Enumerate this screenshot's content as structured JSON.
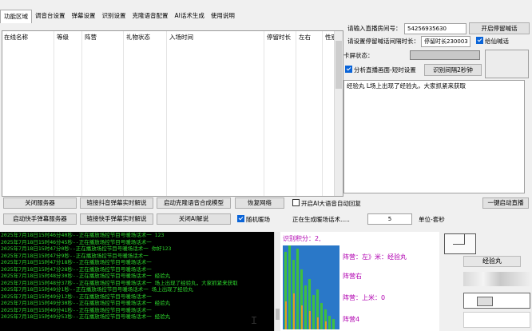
{
  "menu": {
    "tabs": [
      "功能区域",
      "调音台设置",
      "弹幕设置",
      "识别设置",
      "克隆语音配置",
      "AI话术生成",
      "使用说明"
    ]
  },
  "table": {
    "columns": [
      "在线名称",
      "等级",
      "阵营",
      "礼物状态",
      "入场时间",
      "停留时长",
      "左右",
      "性别"
    ]
  },
  "settings": {
    "room_label": "请输入直播房间号：",
    "room_value": "54256935630",
    "start_shout_button": "开启停留喊话",
    "shout_interval_label": "请设置停留喊话间隔时长：",
    "shout_interval_value": "停留时长230003",
    "fairy_shout": "给仙喊话",
    "card_status_label": "卡屏状态：",
    "analyze_check": "分析直播画面-短时设置",
    "recognize_interval_button": "识别间隔2秒钟",
    "message_text": "经验丸 L场上出现了经验丸，大家抓紧来获取"
  },
  "buttons": {
    "close_server": "关闭服务器",
    "link_douyin": "链接抖音弹幕实时解说",
    "start_clone": "启动克隆语音合成模型",
    "restore_network": "恢复网络",
    "ai_auto_reply": "开启AI大语音自动回复",
    "one_key_start": "一键启动直播",
    "start_kuaishou": "启动快手弹幕服务器",
    "link_kuaishou": "链接快手弹幕实时解说",
    "close_ai": "关闭AI解说",
    "random_warm": "随机暖场",
    "generating": "正在生成暖场话术.....",
    "count_value": "5",
    "unit": "单位-套秒"
  },
  "console": {
    "lines": [
      "2025年7月18日15时46分40秒--正在播放场控节目号暖场话术一 123",
      "2025年7月18日15时46分45秒--正在播放场控节目号暖场话术一",
      "2025年7月18日15时47分0秒--正在播放场控节目号暖场话术一 你好123",
      "2025年7月18日15时47分9秒--正在播放场控节目号暖场话术一",
      "2025年7月18日15时47分18秒--正在播放场控节目号暖场话术一",
      "2025年7月18日15时47分28秒--正在播放场控节目号暖场话术一",
      "2025年7月18日15时48分30秒--正在播放场控节目号暖场话术一 经验丸",
      "2025年7月18日15时48分37秒--正在播放场控节目号暖场话术一 场上出现了经验丸，大家抓紧来获取",
      "2025年7月18日15时49分1秒--正在播放场控节目号暖场话术一 场上出现了经验丸",
      "2025年7月18日15时49分12秒--正在播放场控节目号暖场话术一",
      "2025年7月18日15时49分30秒--正在播放场控节目号暖场话术一 经验丸",
      "2025年7月18日15时49分41秒--正在播放场控节目号暖场话术一",
      "2025年7月18日15时49分53秒--正在播放场控节目号暖场话术一 经验丸"
    ]
  },
  "recognition": {
    "score": "识别积分：2,",
    "faction_left": "阵营：左》米：经验丸",
    "faction_right": "阵营右",
    "faction_up": "阵营：上米：0",
    "faction4": "阵营4"
  },
  "side_preview": {
    "label": "经验丸"
  },
  "colors": {
    "console_text": "#2dd62d",
    "accent_magenta": "#b000b0",
    "check_blue": "#0a64d8"
  }
}
